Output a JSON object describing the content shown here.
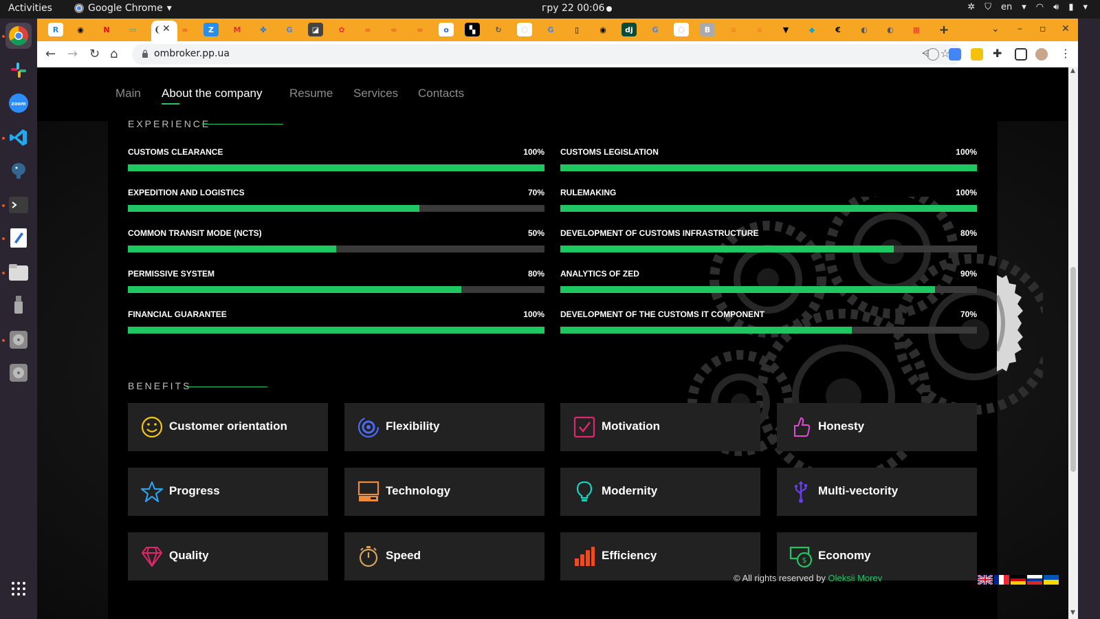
{
  "system": {
    "activities": "Activities",
    "app_name": "Google Chrome",
    "clock": "гру 22  00:06",
    "keyboard_layout": "en"
  },
  "browser": {
    "url": "ombroker.pp.ua"
  },
  "nav": {
    "items": [
      "Main",
      "About the company",
      "Resume",
      "Services",
      "Contacts"
    ],
    "active": "About the company"
  },
  "experience": {
    "title": "EXPERIENCE",
    "skills": [
      {
        "name": "CUSTOMS CLEARANCE",
        "percent_label": "100%",
        "percent": 100
      },
      {
        "name": "CUSTOMS LEGISLATION",
        "percent_label": "100%",
        "percent": 100
      },
      {
        "name": "EXPEDITION AND LOGISTICS",
        "percent_label": "70%",
        "percent": 70
      },
      {
        "name": "RULEMAKING",
        "percent_label": "100%",
        "percent": 100
      },
      {
        "name": "COMMON TRANSIT MODE (NCTS)",
        "percent_label": "50%",
        "percent": 50
      },
      {
        "name": "DEVELOPMENT OF CUSTOMS INFRASTRUCTURE",
        "percent_label": "80%",
        "percent": 80
      },
      {
        "name": "PERMISSIVE SYSTEM",
        "percent_label": "80%",
        "percent": 80
      },
      {
        "name": "ANALYTICS OF ZED",
        "percent_label": "90%",
        "percent": 90
      },
      {
        "name": "FINANCIAL GUARANTEE",
        "percent_label": "100%",
        "percent": 100
      },
      {
        "name": "DEVELOPMENT OF THE CUSTOMS IT COMPONENT",
        "percent_label": "70%",
        "percent": 70
      }
    ]
  },
  "benefits": {
    "title": "BENEFITS",
    "items": [
      {
        "label": "Customer orientation",
        "icon": "smiley-icon",
        "color": "#f5c518"
      },
      {
        "label": "Flexibility",
        "icon": "flexibility-icon",
        "color": "#4a6cf7"
      },
      {
        "label": "Motivation",
        "icon": "checkbox-icon",
        "color": "#e2266b"
      },
      {
        "label": "Honesty",
        "icon": "thumbs-up-icon",
        "color": "#e04ad8"
      },
      {
        "label": "Progress",
        "icon": "star-icon",
        "color": "#2ea0f0"
      },
      {
        "label": "Technology",
        "icon": "computer-icon",
        "color": "#f08a3c"
      },
      {
        "label": "Modernity",
        "icon": "lightbulb-icon",
        "color": "#17d3c4"
      },
      {
        "label": "Multi-vectority",
        "icon": "usb-icon",
        "color": "#6a3df0"
      },
      {
        "label": "Quality",
        "icon": "diamond-icon",
        "color": "#e2266b"
      },
      {
        "label": "Speed",
        "icon": "stopwatch-icon",
        "color": "#d9a45a"
      },
      {
        "label": "Efficiency",
        "icon": "bar-chart-icon",
        "color": "#f04a1e"
      },
      {
        "label": "Economy",
        "icon": "money-icon",
        "color": "#1ec760"
      }
    ]
  },
  "footer": {
    "copyright": "© All rights reserved by",
    "author": "Oleksii Morev"
  },
  "colors": {
    "accent": "#1ec760",
    "track": "#3a3a3a",
    "card_bg": "#222222",
    "tabstrip": "#f6a623"
  }
}
